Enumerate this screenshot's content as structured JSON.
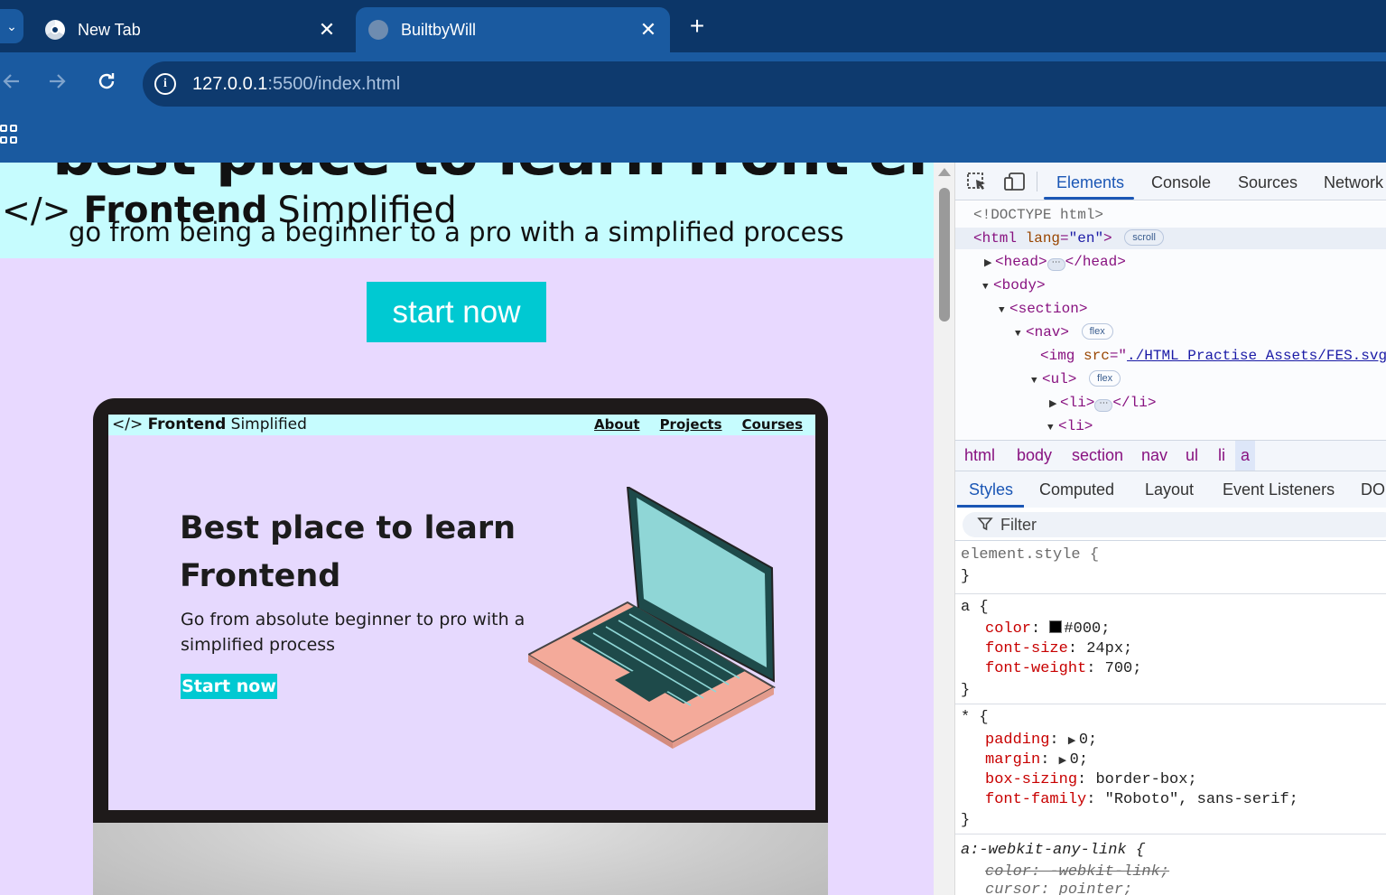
{
  "browser": {
    "tabs": [
      {
        "title": "New Tab",
        "active": false
      },
      {
        "title": "BuiltbyWill",
        "active": true
      }
    ],
    "close_glyph": "✕",
    "new_tab_glyph": "+",
    "menu_glyph": "⌄",
    "url_host": "127.0.0.1",
    "url_path": ":5500/index.html",
    "info_glyph": "i"
  },
  "page": {
    "cut_heading": "best place to learn front end",
    "brand_code": "</>",
    "brand_bold": "Frontend",
    "brand_light": "Simplified",
    "subline": "go from being a beginner to a pro with a simplified process",
    "start_button": "start now",
    "preview": {
      "brand_code": "</>",
      "brand_bold": "Frontend",
      "brand_light": "Simplified",
      "nav_links": [
        "About",
        "Projects",
        "Courses"
      ],
      "headline": "Best place to learn Frontend",
      "paragraph": "Go from absolute beginner to pro with a simplified process",
      "button": "Start now"
    }
  },
  "devtools": {
    "tabs": [
      "Elements",
      "Console",
      "Sources",
      "Network"
    ],
    "active_tab": "Elements",
    "dom": {
      "doctype": "<!DOCTYPE html>",
      "html_open": "<html",
      "html_attr": "lang",
      "html_val": "\"en\"",
      "html_close": ">",
      "scroll_pill": "scroll",
      "head_open": "<head>",
      "head_close": "</head>",
      "body_open": "<body>",
      "section_open": "<section>",
      "nav_open": "<nav>",
      "flex_pill": "flex",
      "img_open": "<img",
      "img_attr": "src",
      "img_eq": "=\"",
      "img_val": "./HTML Practise Assets/FES.svg",
      "ul_open": "<ul>",
      "li_open": "<li>",
      "li_close": "</li>",
      "ellipsis": "⋯"
    },
    "breadcrumbs": [
      "html",
      "body",
      "section",
      "nav",
      "ul",
      "li",
      "a"
    ],
    "sub_tabs": [
      "Styles",
      "Computed",
      "Layout",
      "Event Listeners",
      "DOM"
    ],
    "filter_placeholder": "Filter",
    "styles": {
      "element_style": "element.style {",
      "brace_close": "}",
      "a_selector": "a {",
      "a_color_prop": "color",
      "a_color_val": "#000;",
      "a_size_prop": "font-size",
      "a_size_val": "24px;",
      "a_weight_prop": "font-weight",
      "a_weight_val": "700;",
      "star_selector": "* {",
      "padding_prop": "padding",
      "padding_val": "0;",
      "margin_prop": "margin",
      "margin_val": "0;",
      "boxsizing_prop": "box-sizing",
      "boxsizing_val": "border-box;",
      "fontfamily_prop": "font-family",
      "fontfamily_val": "\"Roboto\", sans-serif;",
      "ua_selector": "a:-webkit-any-link {",
      "ua_color": "color: -webkit-link;",
      "ua_cursor": "cursor: pointer;"
    }
  },
  "colors": {
    "tab_bar": "#0c3668",
    "toolbar": "#1a5aa0",
    "hero_band": "#c6fcfe",
    "page_bg": "#e8d9ff",
    "accent_button": "#00c9d2",
    "devtools_accent": "#1a56b5"
  }
}
